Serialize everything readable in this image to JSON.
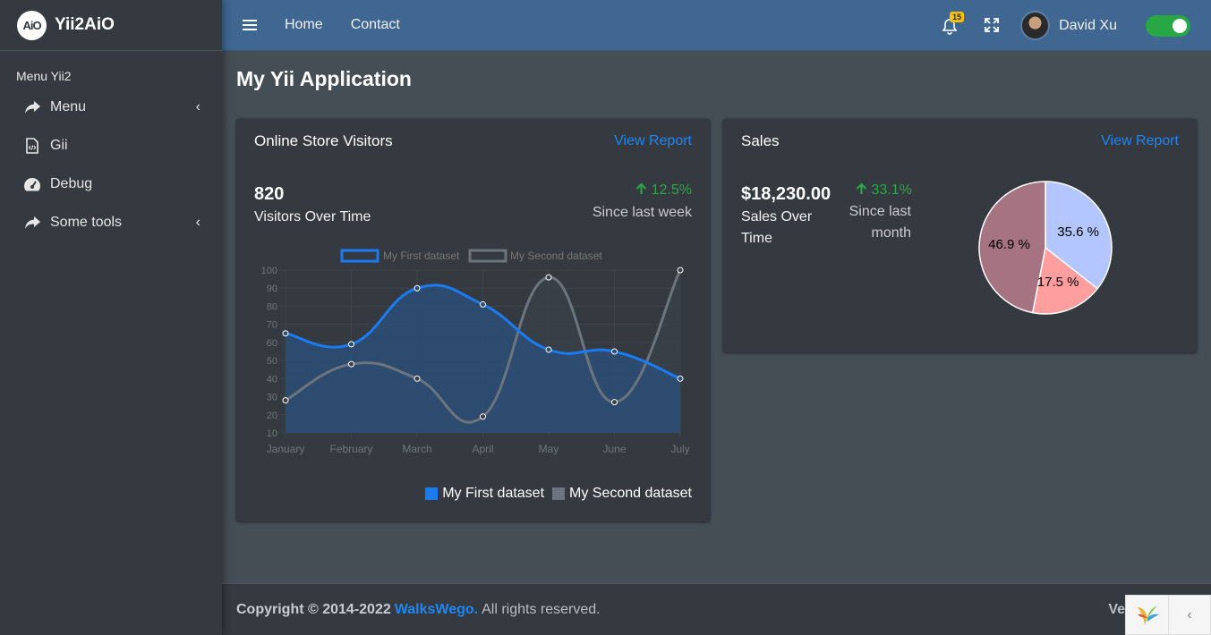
{
  "brand": {
    "logo_text": "AiO",
    "name": "Yii2AiO"
  },
  "sidebar": {
    "header": "Menu Yii2",
    "items": [
      {
        "label": "Menu",
        "icon": "share-icon",
        "has_caret": true
      },
      {
        "label": "Gii",
        "icon": "file-code-icon",
        "has_caret": false
      },
      {
        "label": "Debug",
        "icon": "dashboard-icon",
        "has_caret": false
      },
      {
        "label": "Some tools",
        "icon": "share-icon",
        "has_caret": true
      }
    ],
    "caret": "‹"
  },
  "topbar": {
    "links": [
      "Home",
      "Contact"
    ],
    "notification_count": "15",
    "user_name": "David Xu",
    "toggle_on": true
  },
  "page_title": "My Yii Application",
  "visitors_card": {
    "title": "Online Store Visitors",
    "link": "View Report",
    "value": "820",
    "value_label": "Visitors Over Time",
    "delta": "12.5%",
    "since": "Since last week",
    "legend": [
      "My First dataset",
      "My Second dataset"
    ]
  },
  "sales_card": {
    "title": "Sales",
    "link": "View Report",
    "value": "$18,230.00",
    "value_label": "Sales Over Time",
    "delta": "33.1%",
    "since": "Since last month"
  },
  "chart_data": [
    {
      "type": "line",
      "categories": [
        "January",
        "February",
        "March",
        "April",
        "May",
        "June",
        "July"
      ],
      "series": [
        {
          "name": "My First dataset",
          "values": [
            65,
            59,
            90,
            81,
            56,
            55,
            40
          ],
          "color": "#1a7bf2",
          "fill": "#2c4f78"
        },
        {
          "name": "My Second dataset",
          "values": [
            28,
            48,
            40,
            19,
            96,
            27,
            100
          ],
          "color": "#6c757d",
          "fill": "#3b4148"
        }
      ],
      "ylim": [
        10,
        100
      ],
      "yticks": [
        10,
        20,
        30,
        40,
        50,
        60,
        70,
        80,
        90,
        100
      ],
      "grid": true,
      "legend": "top"
    },
    {
      "type": "pie",
      "labels": [
        "35.6 %",
        "17.5 %",
        "46.9 %"
      ],
      "values": [
        35.6,
        17.5,
        46.9
      ],
      "colors": [
        "#b3c6ff",
        "#ff9e9e",
        "#a57382"
      ]
    }
  ],
  "footer": {
    "copyright_prefix": "Copyright © 2014-2022",
    "company": "WalksWego.",
    "rights": "All rights reserved.",
    "version_prefix": "Ve"
  },
  "colors": {
    "accent": "#1e86f5",
    "success": "#28a745",
    "topbar": "#3f6791",
    "sidebar": "#343a40"
  }
}
